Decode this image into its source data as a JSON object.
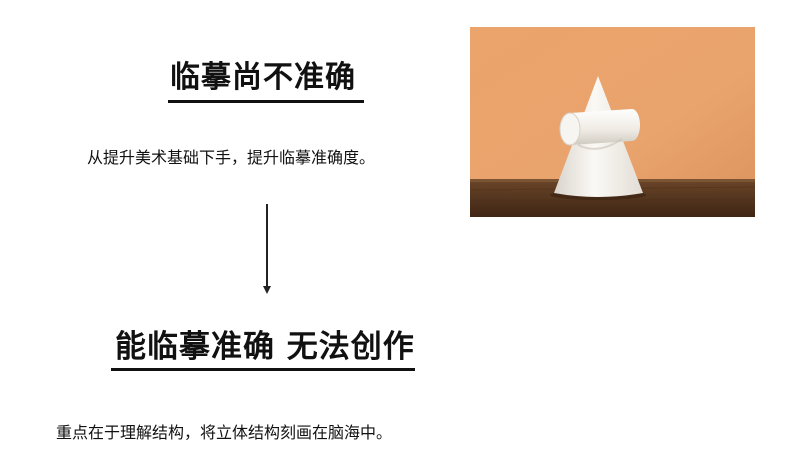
{
  "section1": {
    "heading": "临摹尚不准确",
    "description": "从提升美术基础下手，提升临摹准确度。"
  },
  "section2": {
    "heading": "能临摹准确 无法创作",
    "description": "重点在于理解结构，将立体结构刻画在脑海中。"
  },
  "photo": {
    "subject": "white plaster cone with cylinder cross on wooden table",
    "colors": {
      "wall": "#e7a068",
      "table": "#5a3a22",
      "plaster": "#f4f1ec"
    }
  },
  "colors": {
    "text": "#111111",
    "background": "#ffffff"
  }
}
